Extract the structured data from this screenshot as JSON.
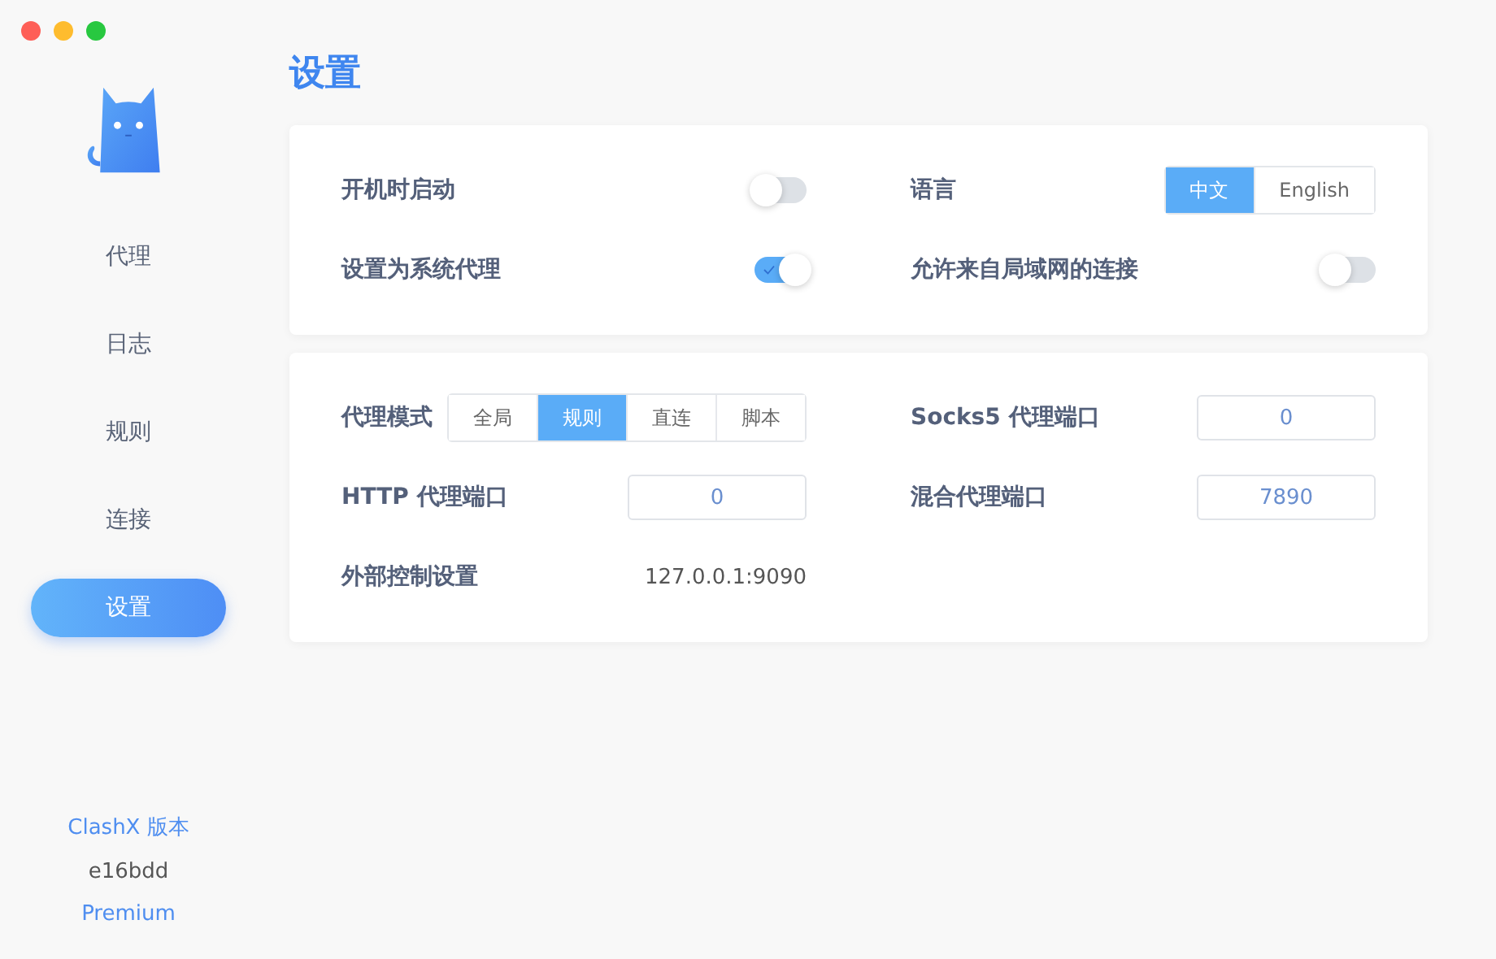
{
  "sidebar": {
    "items": [
      {
        "label": "代理",
        "selected": false
      },
      {
        "label": "日志",
        "selected": false
      },
      {
        "label": "规则",
        "selected": false
      },
      {
        "label": "连接",
        "selected": false
      },
      {
        "label": "设置",
        "selected": true
      }
    ],
    "footer": {
      "version_label": "ClashX 版本",
      "version": "e16bdd",
      "edition": "Premium"
    }
  },
  "title": "设置",
  "cards": [
    {
      "items": [
        {
          "label": "开机时启动",
          "kind": "toggle",
          "on": false
        },
        {
          "label": "语言",
          "kind": "segmented",
          "options": [
            {
              "label": "中文",
              "selected": true
            },
            {
              "label": "English",
              "selected": false
            }
          ]
        },
        {
          "label": "设置为系统代理",
          "kind": "toggle",
          "on": true
        },
        {
          "label": "允许来自局域网的连接",
          "kind": "toggle",
          "on": false
        }
      ]
    },
    {
      "items": [
        {
          "label": "代理模式",
          "kind": "segmented",
          "options": [
            {
              "label": "全局",
              "selected": false
            },
            {
              "label": "规则",
              "selected": true
            },
            {
              "label": "直连",
              "selected": false
            },
            {
              "label": "脚本",
              "selected": false
            }
          ]
        },
        {
          "label": "Socks5 代理端口",
          "kind": "input",
          "value": "0"
        },
        {
          "label": "HTTP 代理端口",
          "kind": "input",
          "value": "0"
        },
        {
          "label": "混合代理端口",
          "kind": "input",
          "value": "7890"
        },
        {
          "label": "外部控制设置",
          "kind": "text",
          "value": "127.0.0.1:9090"
        }
      ]
    }
  ]
}
